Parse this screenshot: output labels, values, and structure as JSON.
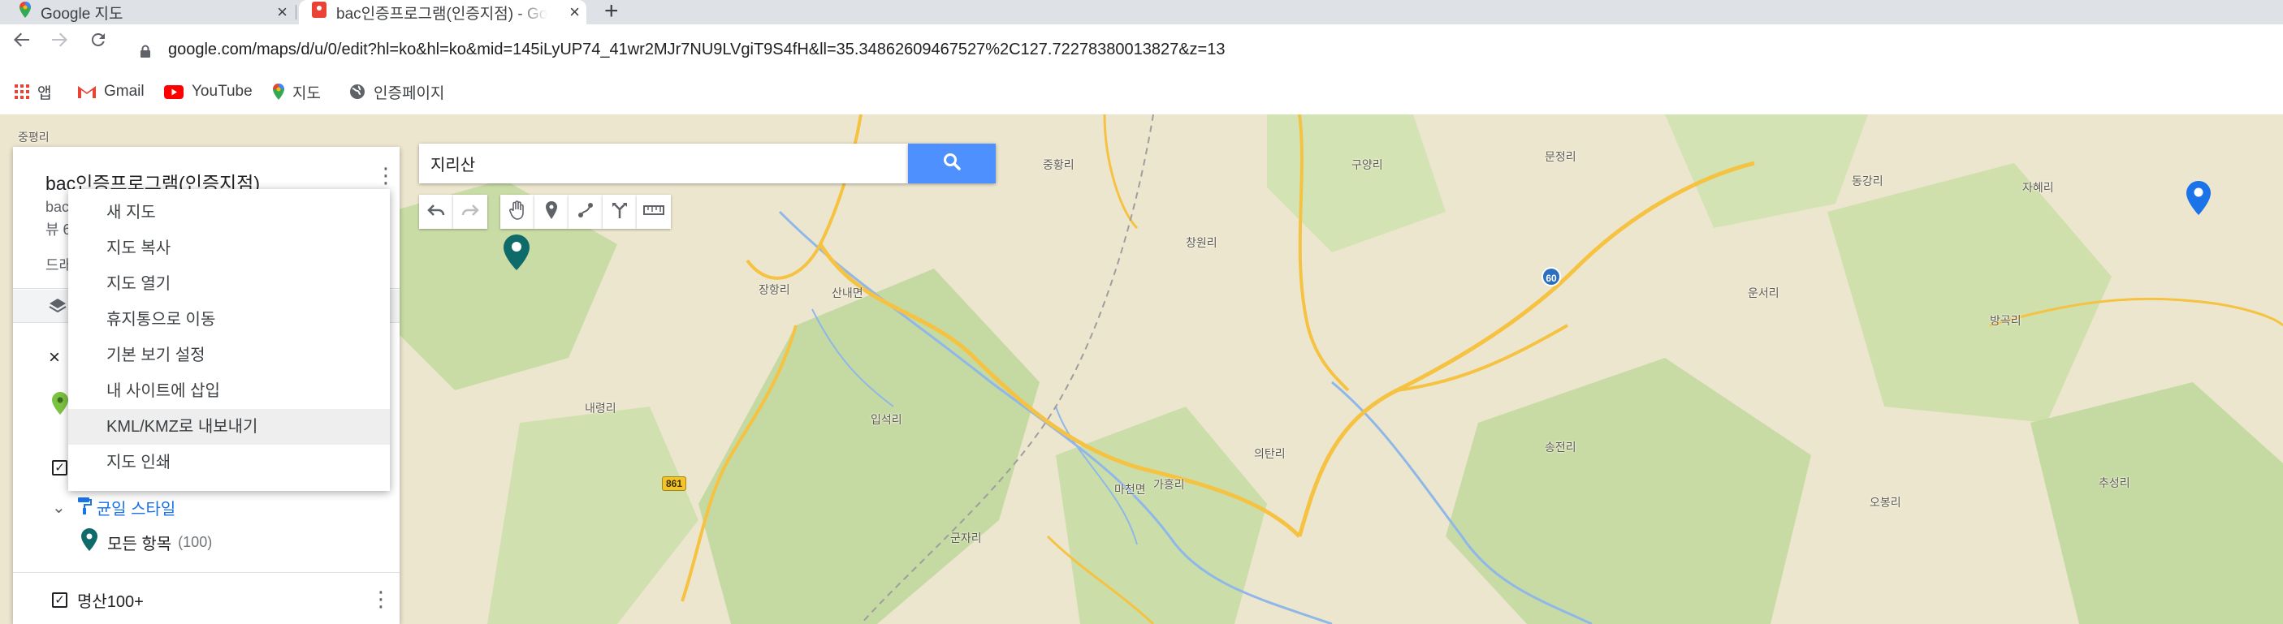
{
  "browser": {
    "tabs": [
      {
        "title": "Google 지도",
        "icon": "google-maps-pin-icon"
      },
      {
        "title": "bac인증프로그램(인증지점) - Go",
        "icon": "my-maps-icon"
      }
    ],
    "new_tab_label": "+",
    "url": "google.com/maps/d/u/0/edit?hl=ko&hl=ko&mid=145iLyUP74_41wr2MJr7NU9LVgiT9S4fH&ll=35.34862609467527%2C127.72278380013827&z=13",
    "bookmarks": [
      {
        "label": "앱",
        "icon": "apps-grid-icon"
      },
      {
        "label": "Gmail",
        "icon": "gmail-icon"
      },
      {
        "label": "YouTube",
        "icon": "youtube-icon"
      },
      {
        "label": "지도",
        "icon": "maps-pin-icon"
      },
      {
        "label": "인증페이지",
        "icon": "globe-icon"
      }
    ]
  },
  "search": {
    "value": "지리산"
  },
  "panel": {
    "title": "bac인증프로그램(인증지점)",
    "sub1": "bac",
    "sub2": "뷰 6",
    "sub3": "드래",
    "layer_style_label": "균일 스타일",
    "all_items_label": "모든 항목",
    "all_items_count": "(100)",
    "layer2_title": "명산100+",
    "close_glyph": "×"
  },
  "menu": {
    "items": [
      "새 지도",
      "지도 복사",
      "지도 열기",
      "휴지통으로 이동",
      "기본 보기 설정",
      "내 사이트에 삽입",
      "KML/KMZ로 내보내기",
      "지도 인쇄"
    ],
    "hovered_index": 6
  },
  "map": {
    "places": [
      "중평리",
      "중황리",
      "구양리",
      "문정리",
      "동강리",
      "자혜리",
      "창원리",
      "산내면",
      "장항리",
      "운서리",
      "방곡리",
      "내령리",
      "입석리",
      "송전리",
      "의탄리",
      "마천면",
      "가흥리",
      "군자리",
      "오봉리",
      "추성리"
    ],
    "road_shields": [
      "861",
      "60"
    ],
    "colors": {
      "land": "#ece6cf",
      "forest": "#c5d9a2",
      "road": "#f5c242",
      "water": "#8fb7e8",
      "marker_teal": "#0f6a6a",
      "marker_blue": "#1a73e8"
    }
  },
  "colors": {
    "search_button": "#4d90fe",
    "link": "#1a73e8",
    "tab_strip": "#dee1e6"
  }
}
